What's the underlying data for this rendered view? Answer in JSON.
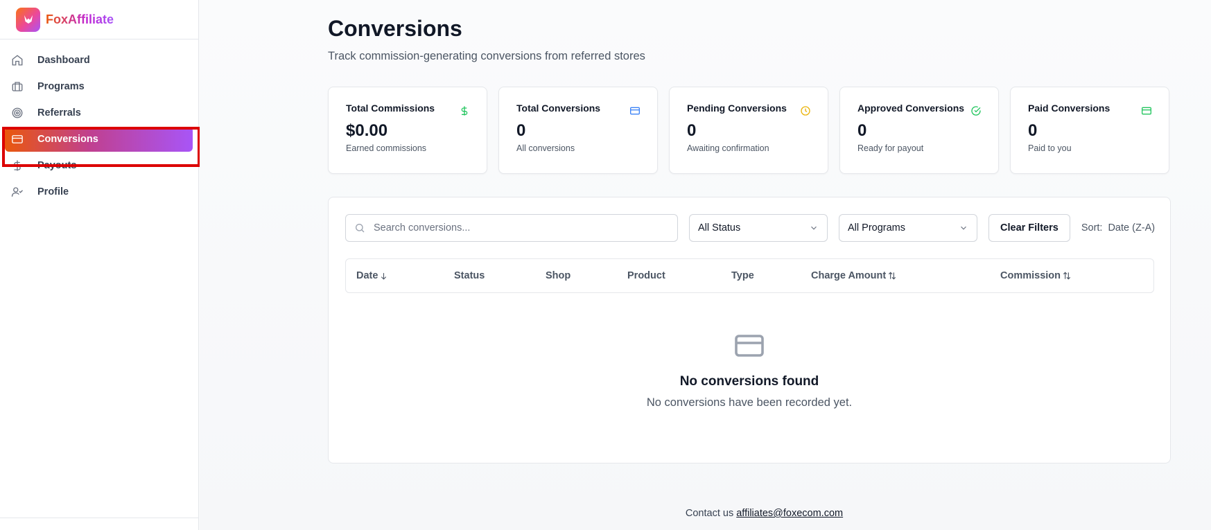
{
  "app": {
    "name": "FoxAffiliate"
  },
  "sidebar": {
    "items": [
      {
        "label": "Dashboard",
        "icon": "home-icon",
        "active": false
      },
      {
        "label": "Programs",
        "icon": "briefcase-icon",
        "active": false
      },
      {
        "label": "Referrals",
        "icon": "target-icon",
        "active": false
      },
      {
        "label": "Conversions",
        "icon": "credit-card-icon",
        "active": true
      },
      {
        "label": "Payouts",
        "icon": "dollar-icon",
        "active": false
      },
      {
        "label": "Profile",
        "icon": "user-check-icon",
        "active": false
      }
    ]
  },
  "page": {
    "title": "Conversions",
    "subtitle": "Track commission-generating conversions from referred stores"
  },
  "stats": [
    {
      "label": "Total Commissions",
      "value": "$0.00",
      "sub": "Earned commissions",
      "icon": "dollar-icon",
      "color": "#22c55e"
    },
    {
      "label": "Total Conversions",
      "value": "0",
      "sub": "All conversions",
      "icon": "credit-card-icon",
      "color": "#3b82f6"
    },
    {
      "label": "Pending Conversions",
      "value": "0",
      "sub": "Awaiting confirmation",
      "icon": "clock-icon",
      "color": "#eab308"
    },
    {
      "label": "Approved Conversions",
      "value": "0",
      "sub": "Ready for payout",
      "icon": "check-circle-icon",
      "color": "#22c55e"
    },
    {
      "label": "Paid Conversions",
      "value": "0",
      "sub": "Paid to you",
      "icon": "credit-card-icon",
      "color": "#22c55e"
    }
  ],
  "filters": {
    "search_placeholder": "Search conversions...",
    "status_value": "All Status",
    "programs_value": "All Programs",
    "clear_label": "Clear Filters",
    "sort_label": "Sort:",
    "sort_value": "Date (Z-A)"
  },
  "table": {
    "columns": [
      "Date",
      "Status",
      "Shop",
      "Product",
      "Type",
      "Charge Amount",
      "Commission"
    ]
  },
  "empty": {
    "title": "No conversions found",
    "message": "No conversions have been recorded yet."
  },
  "footer": {
    "text": "Contact us",
    "email": "affiliates@foxecom.com"
  },
  "colors": {
    "accent_start": "#ea580c",
    "accent_end": "#a855f7",
    "annotation": "#dc0000"
  }
}
